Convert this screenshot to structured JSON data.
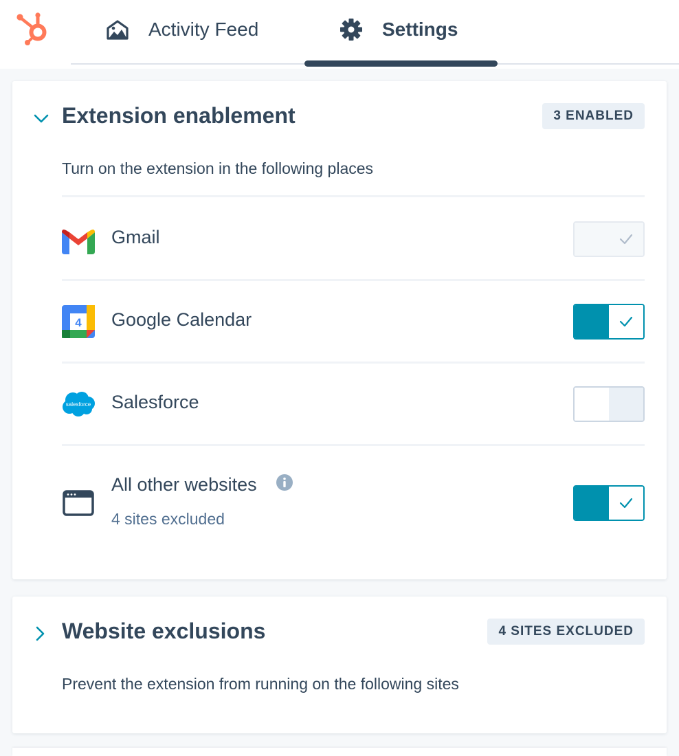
{
  "nav": {
    "tabs": [
      {
        "label": "Activity Feed",
        "icon": "home-activity-icon"
      },
      {
        "label": "Settings",
        "icon": "gear-icon",
        "active": true
      }
    ]
  },
  "extension_enablement": {
    "title": "Extension enablement",
    "badge": "3 ENABLED",
    "description": "Turn on the extension in the following places",
    "expanded": true,
    "items": [
      {
        "label": "Gmail",
        "icon": "gmail-icon",
        "state": "disabled"
      },
      {
        "label": "Google Calendar",
        "icon": "google-calendar-icon",
        "state": "on"
      },
      {
        "label": "Salesforce",
        "icon": "salesforce-icon",
        "state": "off"
      },
      {
        "label": "All other websites",
        "icon": "browser-window-icon",
        "sublabel": "4 sites excluded",
        "state": "on"
      }
    ]
  },
  "website_exclusions": {
    "title": "Website exclusions",
    "badge": "4 SITES EXCLUDED",
    "description": "Prevent the extension from running on the following sites",
    "expanded": false
  },
  "icons": {
    "salesforce_text": "salesforce",
    "calendar_day": "4"
  },
  "colors": {
    "brand_orange": "#ff7a59",
    "accent_teal": "#0091ae",
    "text_dark": "#33475b",
    "text_link": "#516f90",
    "badge_bg": "#eaf0f6"
  }
}
